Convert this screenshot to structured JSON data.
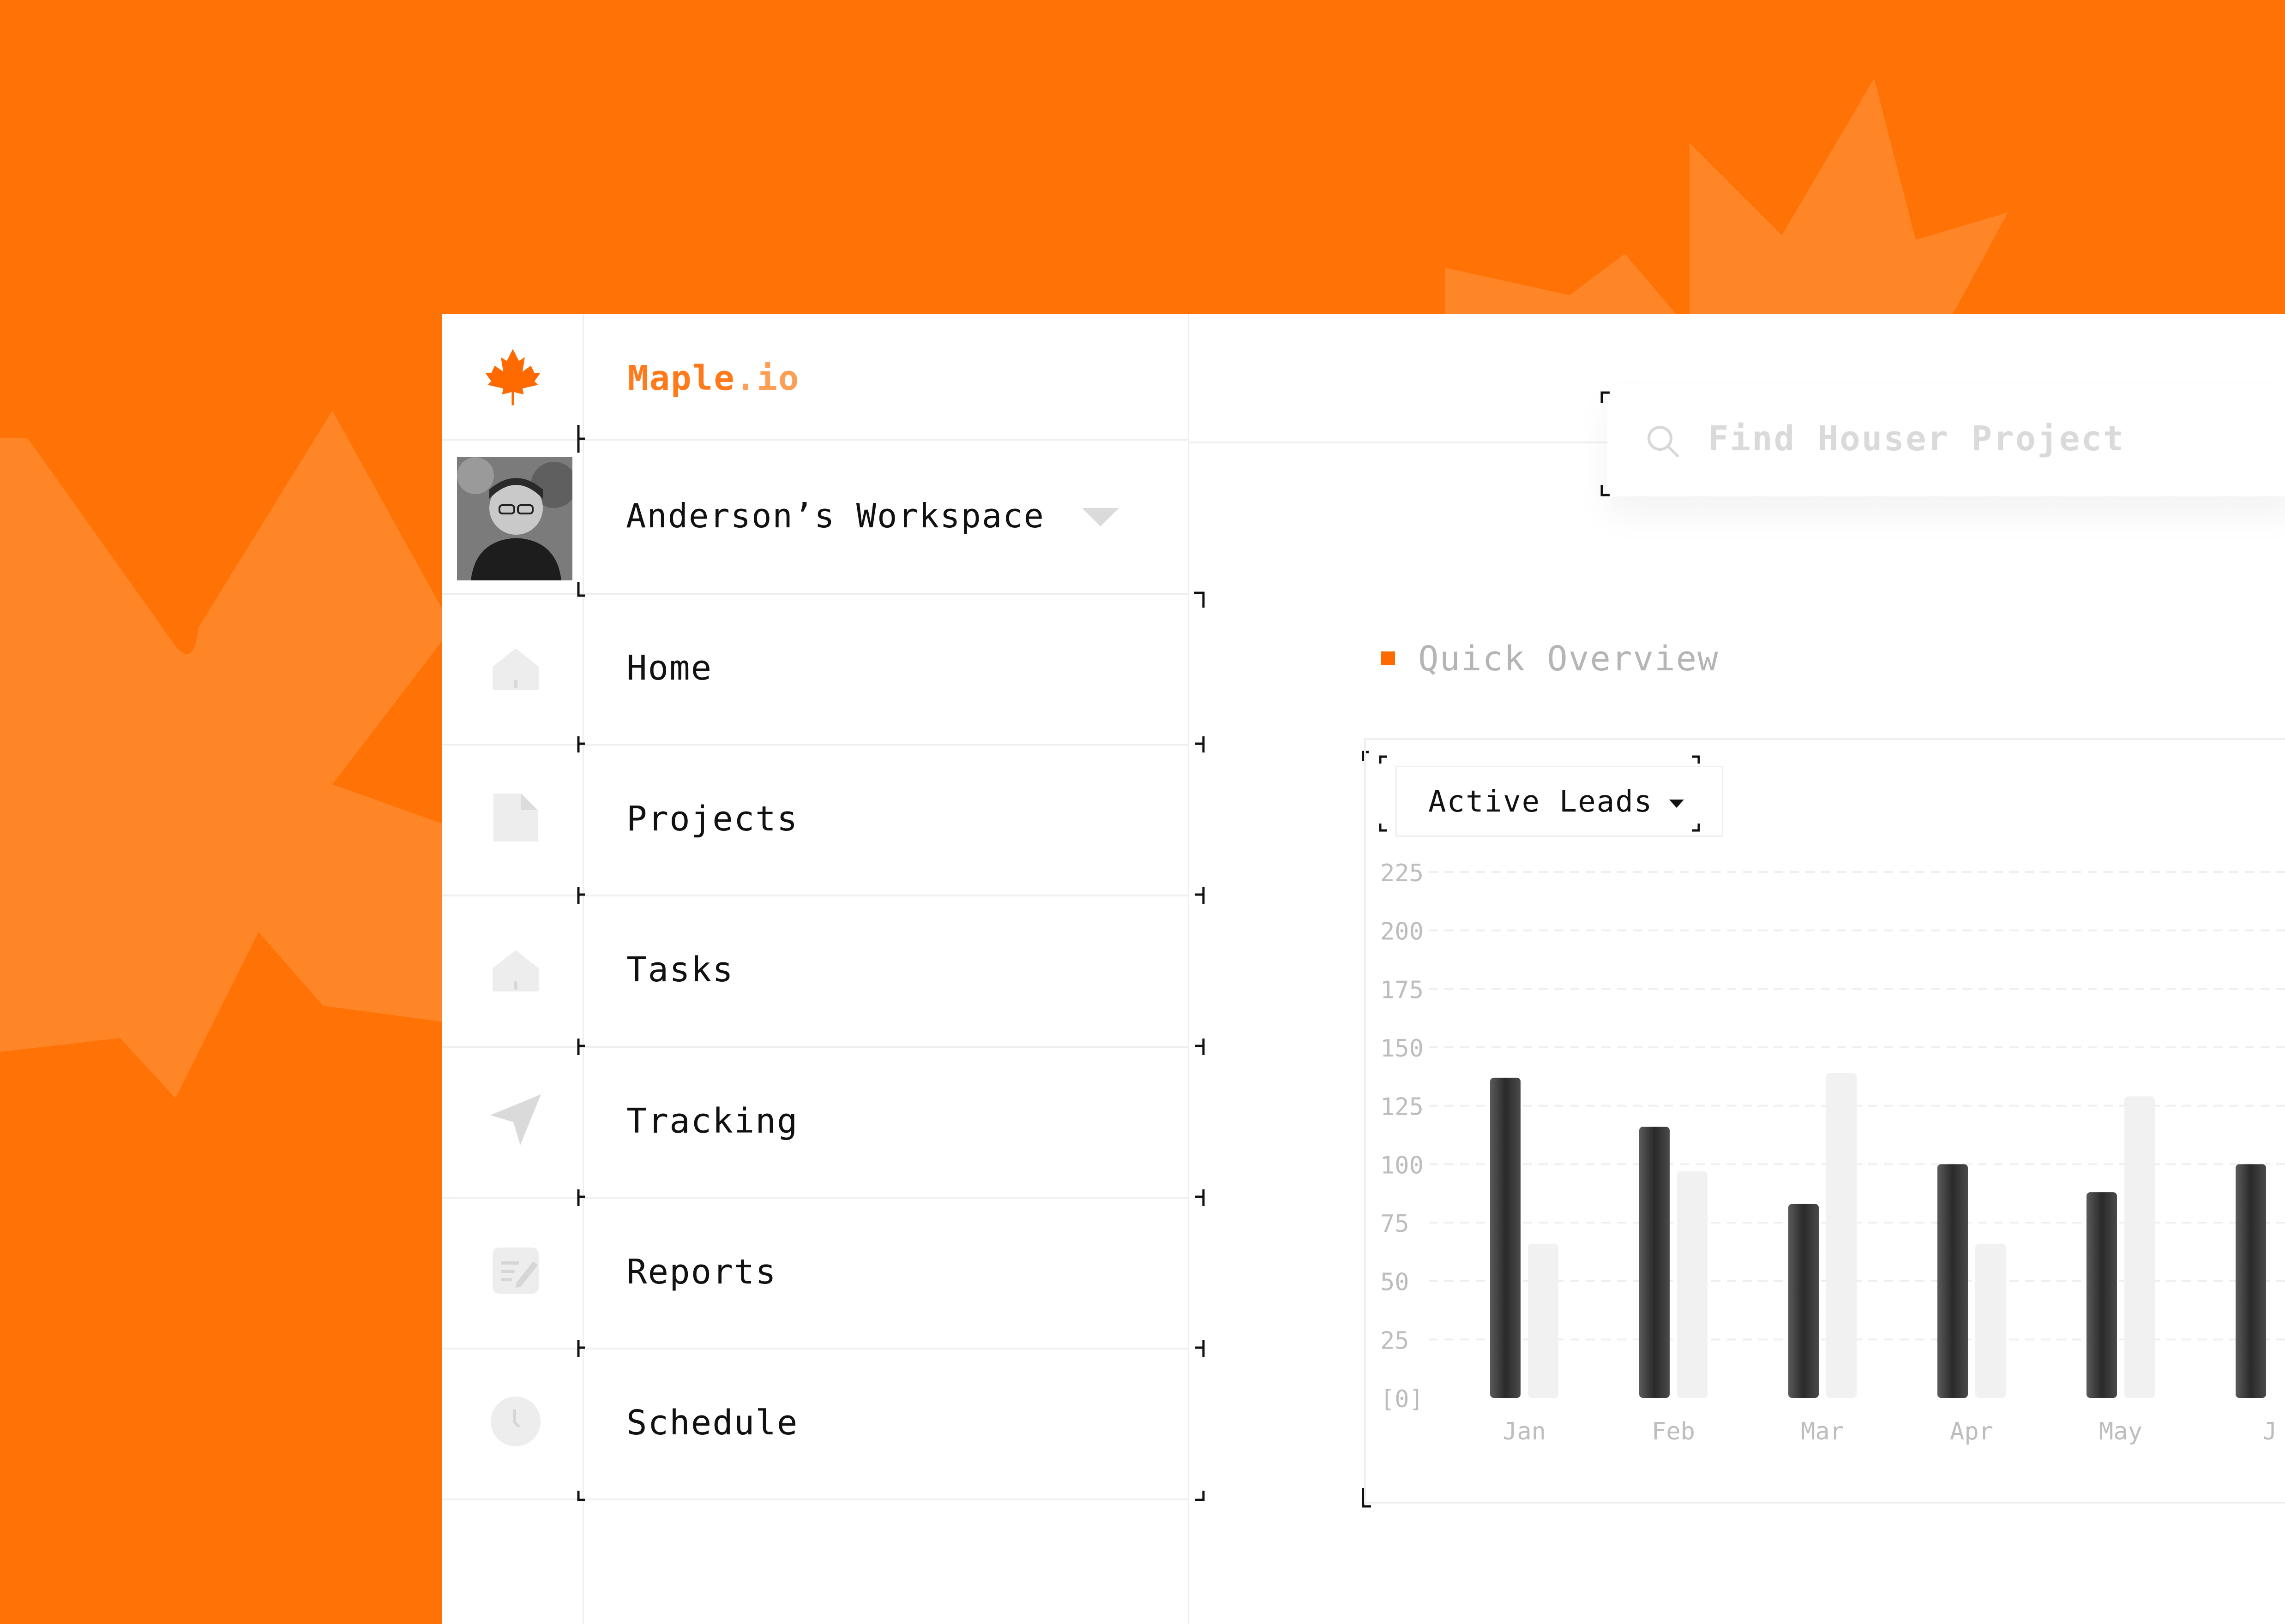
{
  "app": {
    "brand_main": "Maple",
    "brand_suffix": ".io",
    "workspace": "Anderson’s Workspace"
  },
  "search": {
    "placeholder": "Find Houser Project"
  },
  "nav": [
    {
      "label": "Home",
      "icon": "home-icon"
    },
    {
      "label": "Projects",
      "icon": "document-icon"
    },
    {
      "label": "Tasks",
      "icon": "home-icon"
    },
    {
      "label": "Tracking",
      "icon": "send-icon"
    },
    {
      "label": "Reports",
      "icon": "edit-note-icon"
    },
    {
      "label": "Schedule",
      "icon": "clock-icon"
    }
  ],
  "overview": {
    "title": "Quick Overview",
    "dropdown": "Active Leads"
  },
  "colors": {
    "accent": "#FF7205",
    "bar_dark": "#3A3A3A",
    "bar_light": "#F1F1F1"
  },
  "chart_data": {
    "type": "bar",
    "categories": [
      "Jan",
      "Feb",
      "Mar",
      "Apr",
      "May",
      "J"
    ],
    "series": [
      {
        "values": [
          137,
          116,
          83,
          100,
          88,
          100
        ]
      },
      {
        "values": [
          66,
          97,
          139,
          66,
          129,
          null
        ]
      }
    ],
    "yticks": [
      "[0]",
      "25",
      "50",
      "75",
      "100",
      "125",
      "150",
      "175",
      "200",
      "225"
    ],
    "ylim": [
      0,
      225
    ],
    "grid": true
  }
}
